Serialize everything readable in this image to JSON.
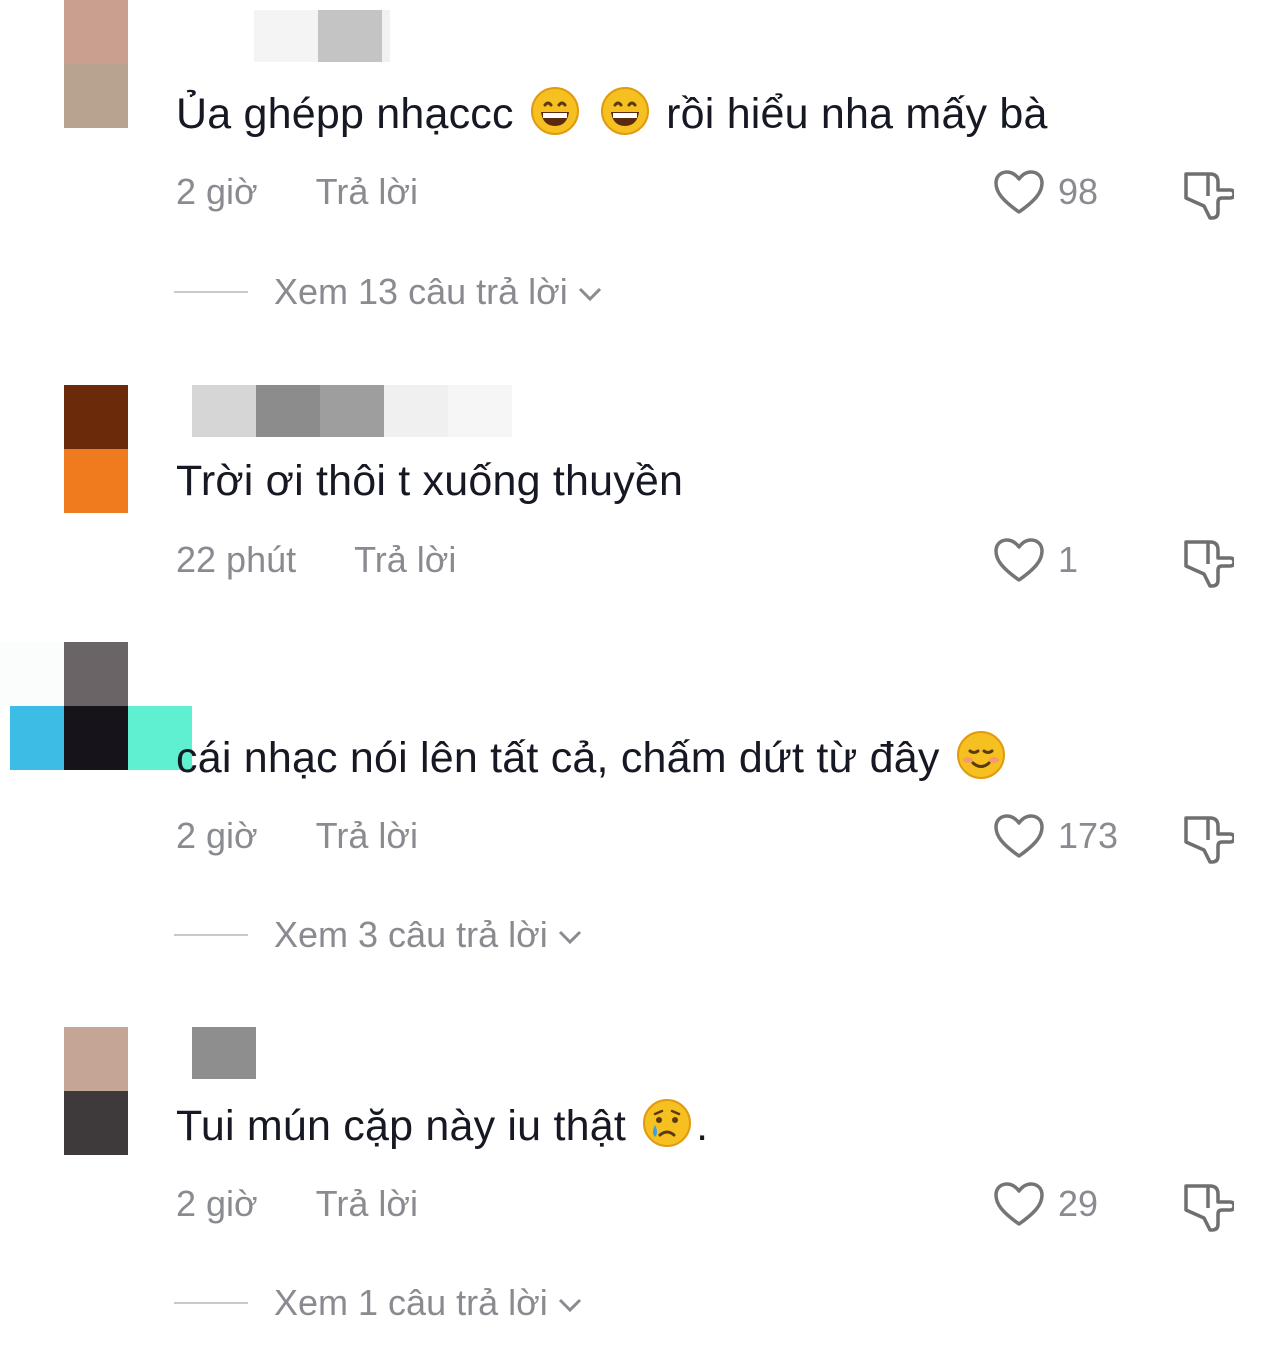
{
  "comments": [
    {
      "text_before": "Ủa ghépp nhạccc",
      "text_after": "rồi hiểu nha mấy bà",
      "time": "2 giờ",
      "reply_label": "Trả lời",
      "likes": "98",
      "view_replies": "Xem 13 câu trả lời",
      "avatar_colors": [
        "#c9a090",
        "#b8a48e"
      ]
    },
    {
      "text": "Trời ơi thôi t xuống thuyền",
      "time": "22 phút",
      "reply_label": "Trả lời",
      "likes": "1",
      "avatar_colors": [
        "#6b2a0a",
        "#f07a1e"
      ]
    },
    {
      "text": "cái nhạc nói lên tất cả, chấm dứt từ đây",
      "time": "2 giờ",
      "reply_label": "Trả lời",
      "likes": "173",
      "view_replies": "Xem 3 câu trả lời",
      "avatar_colors": [
        "#6a6466",
        "#16141a",
        "#3cbde6",
        "#5ff0d2"
      ]
    },
    {
      "text_before": "Tui mún cặp này iu thật",
      "text_after": ".",
      "time": "2 giờ",
      "reply_label": "Trả lời",
      "likes": "29",
      "view_replies": "Xem 1 câu trả lời",
      "avatar_colors": [
        "#c4a596",
        "#3e3a3b"
      ]
    }
  ],
  "icons": {
    "like": "heart-outline-icon",
    "dislike": "thumbs-down-icon",
    "expand": "chevron-down-icon"
  }
}
